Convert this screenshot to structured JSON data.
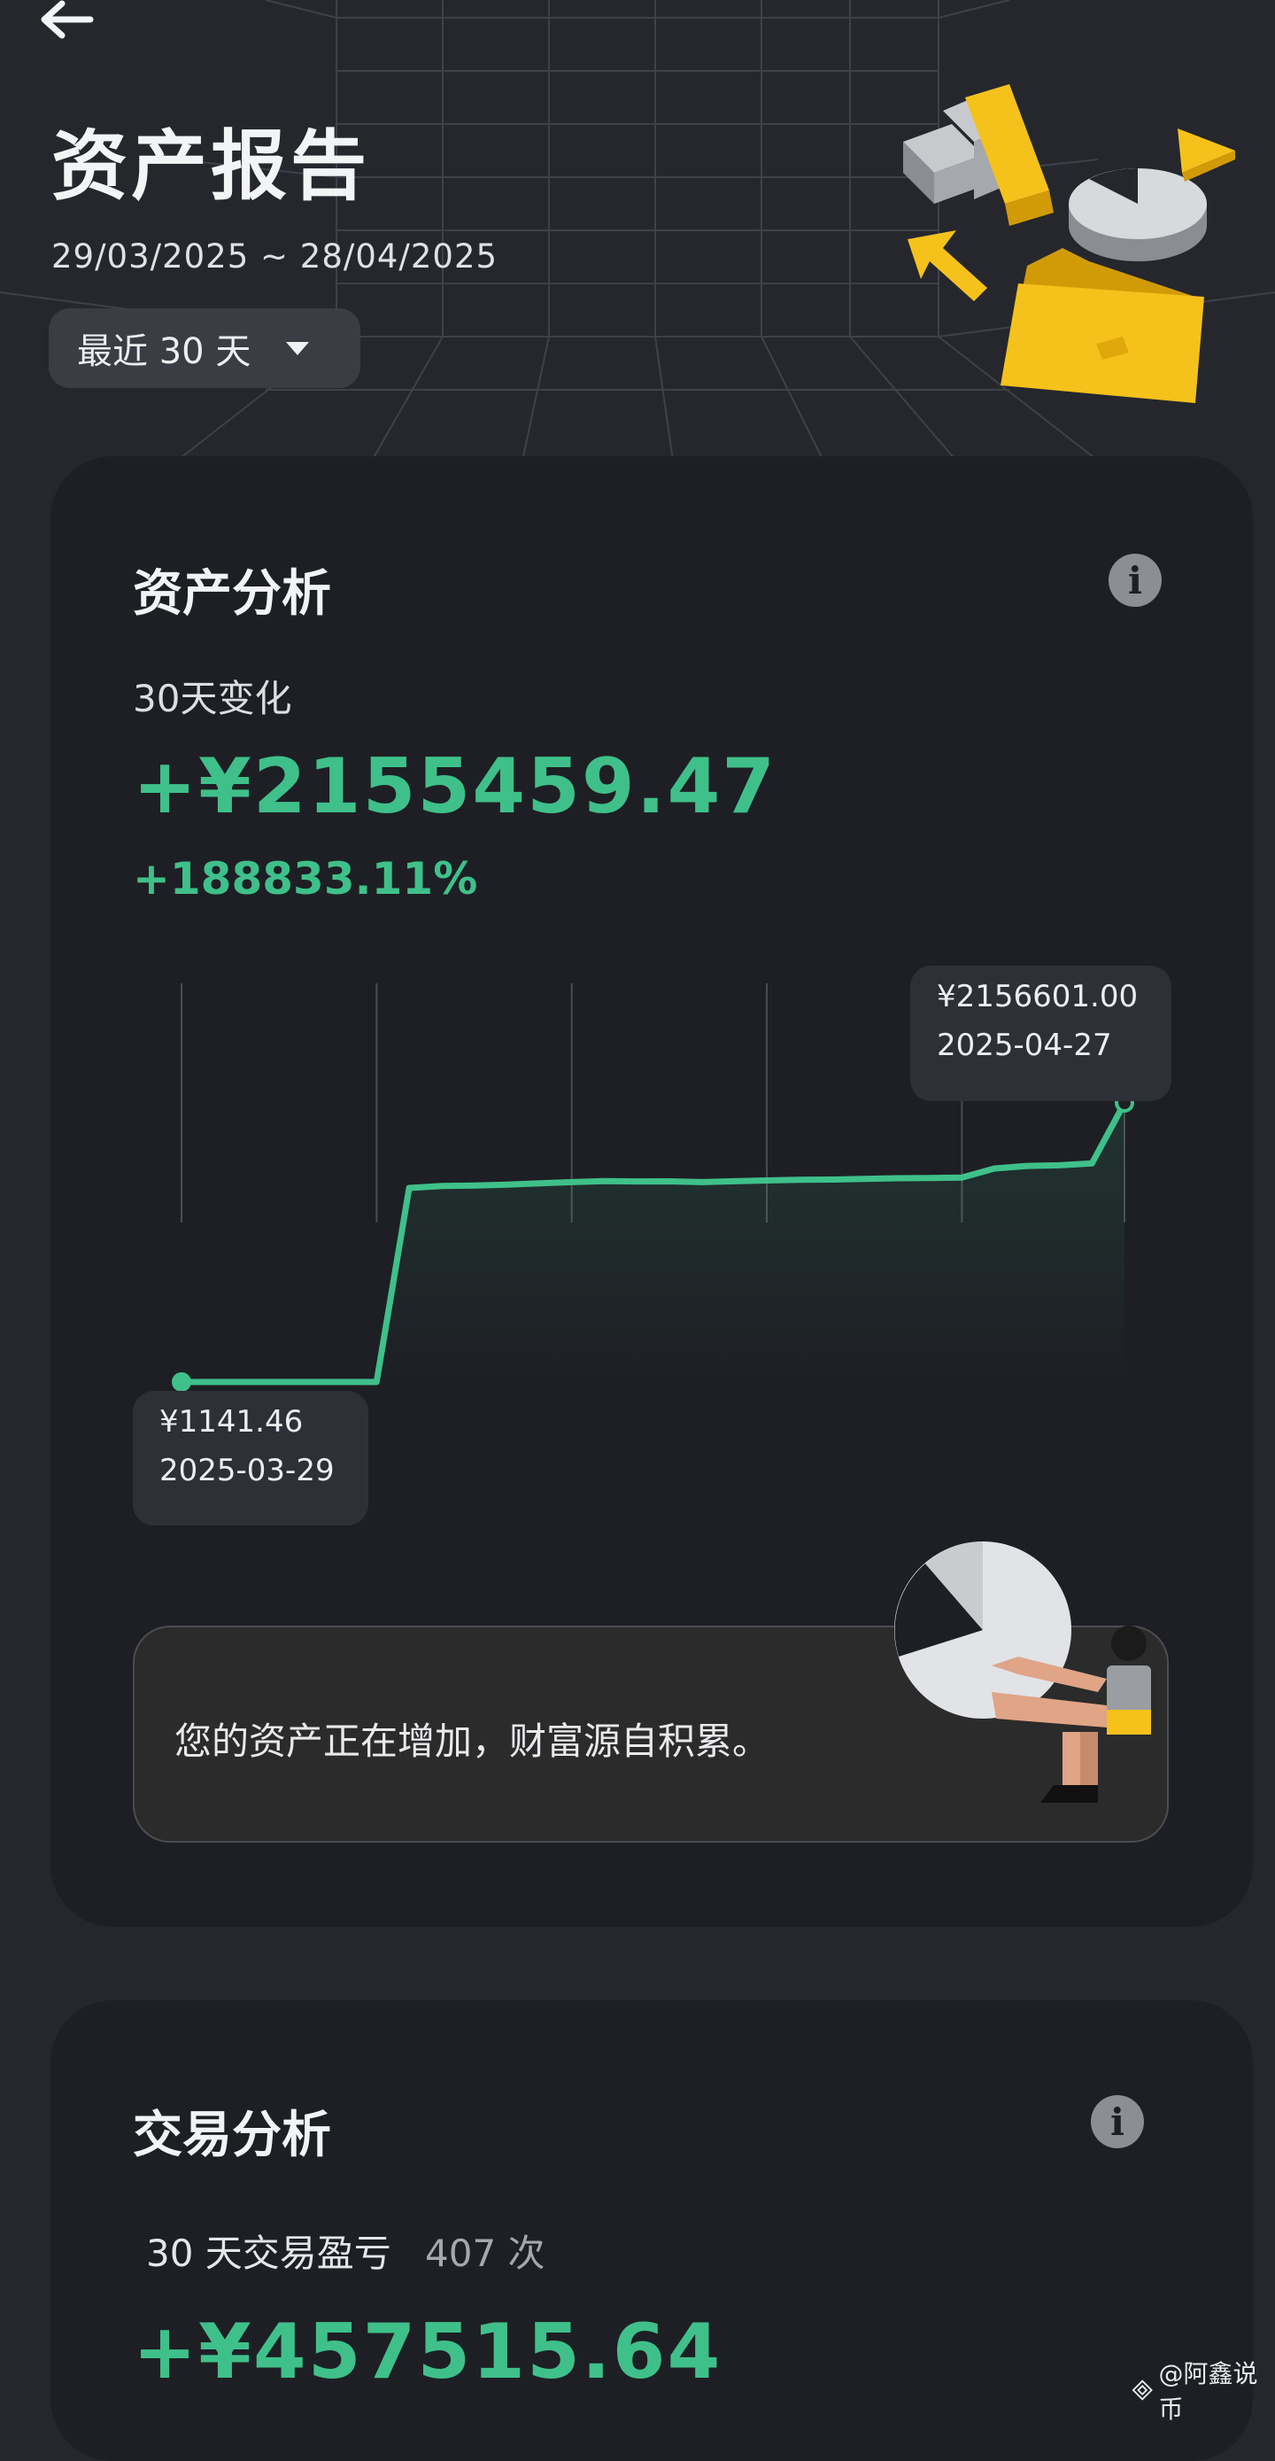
{
  "header": {
    "back_icon": "arrow-left-icon",
    "title": "资产报告",
    "date_range": "29/03/2025 ~ 28/04/2025",
    "range_select": {
      "label": "最近 30 天",
      "icon": "caret-down-icon"
    }
  },
  "asset_card": {
    "title": "资产分析",
    "info_icon": "info-icon",
    "info_symbol": "i",
    "change_label": "30天变化",
    "change_value": "+¥2155459.47",
    "change_percent": "+188833.11%",
    "end_tooltip": {
      "value": "¥2156601.00",
      "date": "2025-04-27"
    },
    "start_tooltip": {
      "value": "¥1141.46",
      "date": "2025-03-29"
    },
    "message": "您的资产正在增加，财富源自积累。"
  },
  "trade_card": {
    "title": "交易分析",
    "info_icon": "info-icon",
    "info_symbol": "i",
    "pnl_label": "30 天交易盈亏",
    "trade_count": "407 次",
    "pnl_value": "+¥457515.64"
  },
  "watermark": {
    "icon": "binance-logo-icon",
    "text": "@阿鑫说币"
  },
  "colors": {
    "background": "#25272d",
    "card": "#1d1f24",
    "positive": "#3fc08a",
    "accent": "#f5c11b"
  },
  "chart_data": {
    "type": "line",
    "title": "",
    "xlabel": "",
    "ylabel": "",
    "grid": false,
    "x": [
      "2025-03-29",
      "2025-03-30",
      "2025-03-31",
      "2025-04-01",
      "2025-04-02",
      "2025-04-03",
      "2025-04-04",
      "2025-04-05",
      "2025-04-06",
      "2025-04-07",
      "2025-04-08",
      "2025-04-09",
      "2025-04-10",
      "2025-04-11",
      "2025-04-12",
      "2025-04-13",
      "2025-04-14",
      "2025-04-15",
      "2025-04-16",
      "2025-04-17",
      "2025-04-18",
      "2025-04-19",
      "2025-04-20",
      "2025-04-21",
      "2025-04-22",
      "2025-04-23",
      "2025-04-24",
      "2025-04-25",
      "2025-04-26",
      "2025-04-27"
    ],
    "series": [
      {
        "color": "#3fc08a",
        "values": [
          1141.46,
          1141.46,
          1141.46,
          1141.46,
          1141.46,
          1141.46,
          1141.46,
          1500000,
          1515000,
          1518000,
          1525000,
          1535000,
          1545000,
          1553000,
          1550000,
          1551000,
          1545000,
          1552000,
          1558000,
          1563000,
          1565000,
          1570000,
          1575000,
          1577000,
          1580000,
          1650000,
          1670000,
          1675000,
          1690000,
          2156601.0
        ]
      }
    ],
    "annotations": [
      {
        "x": "2025-04-27",
        "value": "¥2156601.00",
        "date": "2025-04-27"
      },
      {
        "x": "2025-03-29",
        "value": "¥1141.46",
        "date": "2025-03-29"
      }
    ]
  }
}
